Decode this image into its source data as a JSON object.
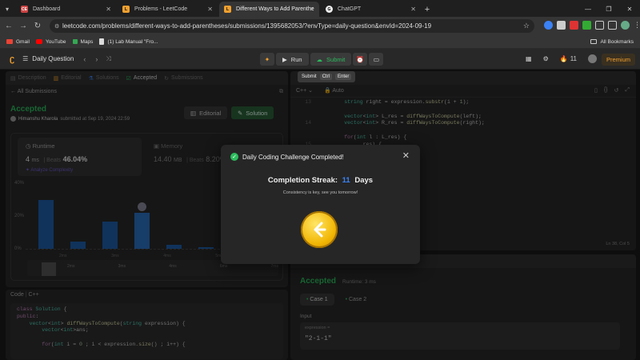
{
  "browser": {
    "tabs": [
      {
        "title": "Dashboard",
        "fav": "CE",
        "active": false
      },
      {
        "title": "Problems - LeetCode",
        "fav": "L",
        "active": false
      },
      {
        "title": "Different Ways to Add Parenthe",
        "fav": "L",
        "active": true
      },
      {
        "title": "ChatGPT",
        "fav": "G",
        "active": false
      }
    ],
    "url": "leetcode.com/problems/different-ways-to-add-parentheses/submissions/1395682053/?envType=daily-question&envId=2024-09-19",
    "bookmarks": [
      "Gmail",
      "YouTube",
      "Maps",
      "(1) Lab Manual \"Fro..."
    ],
    "all_bookmarks": "All Bookmarks"
  },
  "nav": {
    "daily_question": "Daily Question",
    "run": "Run",
    "submit": "Submit",
    "streak_count": "11",
    "premium": "Premium"
  },
  "left": {
    "tabs": [
      "Description",
      "Editorial",
      "Solutions",
      "Accepted",
      "Submissions"
    ],
    "back": "All Submissions",
    "status": "Accepted",
    "user": "Himanshu Kharola",
    "submitted": "submitted at Sep 19, 2024 22:59",
    "editorial_btn": "Editorial",
    "solution_btn": "Solution",
    "runtime_label": "Runtime",
    "runtime_value": "4",
    "runtime_unit": "ms",
    "beats_label": "Beats",
    "beats_value": "46.04%",
    "analyze": "Analyze Complexity",
    "memory_label": "Memory",
    "memory_value": "14.40",
    "memory_unit": "MB",
    "memory_beats_label": "Beats",
    "memory_beats_value": "8.20%",
    "chart_y": [
      "40%",
      "20%",
      "0%"
    ],
    "chart_x": [
      "2ms",
      "3ms",
      "4ms",
      "5ms",
      "6ms"
    ],
    "chart_x2": [
      "2ms",
      "3ms",
      "4ms",
      "6ms",
      "7ms"
    ],
    "code_tab": "Code",
    "code_lang": "C++"
  },
  "chart_data": {
    "type": "bar",
    "categories": [
      "1ms",
      "2ms",
      "3ms",
      "4ms",
      "5ms",
      "6ms"
    ],
    "values": [
      34,
      5,
      19,
      25,
      3,
      1
    ],
    "ylim": [
      0,
      45
    ]
  },
  "editor": {
    "lang": "C++",
    "auto": "Auto",
    "cursor": "Ln 38, Col 5",
    "line_numbers": [
      "13",
      "14",
      "15",
      "16",
      "17"
    ],
    "lines": [
      "        string right = expression.substr(i + 1);",
      "",
      "        vector<int> L_res = diffWaysToCompute(left);",
      "        vector<int> R_res = diffWaysToCompute(right);",
      "",
      "        for(int l : L_res) {",
      "              res) {",
      "              {",
      "              h_back(l + r);",
      "",
      "              == '-') {",
      "              h_back(l - r);",
      "",
      "              == '*') {",
      "              h_back(l * r);"
    ]
  },
  "result": {
    "accepted": "Accepted",
    "runtime": "Runtime: 3 ms",
    "cases": [
      "Case 1",
      "Case 2"
    ],
    "input_label": "Input",
    "var_name": "expression =",
    "var_value": "\"2-1-1\""
  },
  "submit_tooltip": {
    "label": "Submit",
    "k1": "Ctrl",
    "k2": "Enter"
  },
  "code_lines": [
    "class Solution {",
    "public:",
    "    vector<int> diffWaysToCompute(string expression) {",
    "        vector<int>ans;",
    "",
    "        for(int i = 0 ; i < expression.size() ; i++) {"
  ],
  "modal": {
    "title": "Daily Coding Challenge Completed!",
    "streak_prefix": "Completion Streak:",
    "streak_num": "11",
    "streak_suffix": "Days",
    "sub": "Consistency is key, see you tomorrow!"
  }
}
